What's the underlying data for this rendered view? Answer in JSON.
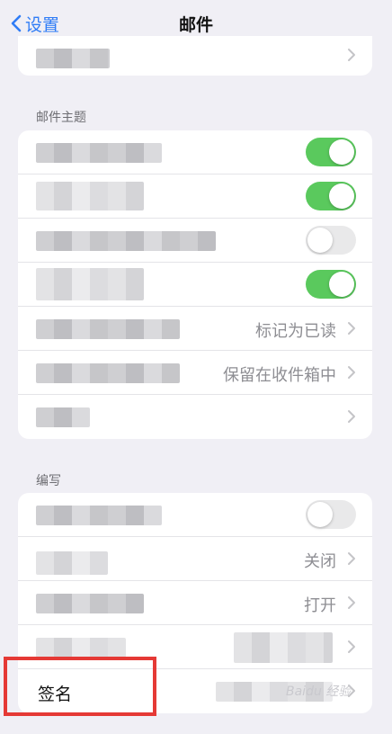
{
  "nav": {
    "back_label": "设置",
    "title": "邮件"
  },
  "sections": {
    "mail_theme": "邮件主题",
    "compose": "编写"
  },
  "mail_theme_rows": [
    {
      "toggle": "on"
    },
    {
      "toggle": "on"
    },
    {
      "toggle": "off"
    },
    {
      "toggle": "on"
    },
    {
      "value": "标记为已读"
    },
    {
      "value": "保留在收件箱中"
    },
    {
      "value": ""
    }
  ],
  "compose_rows": [
    {
      "toggle": "off"
    },
    {
      "value": "关闭"
    },
    {
      "value": "打开"
    },
    {
      "value": ""
    },
    {
      "label": "签名"
    }
  ],
  "watermark": "Baidu 经验",
  "colors": {
    "accent": "#2f7cf6",
    "toggle_on": "#5ac95d",
    "highlight": "#e53935"
  }
}
